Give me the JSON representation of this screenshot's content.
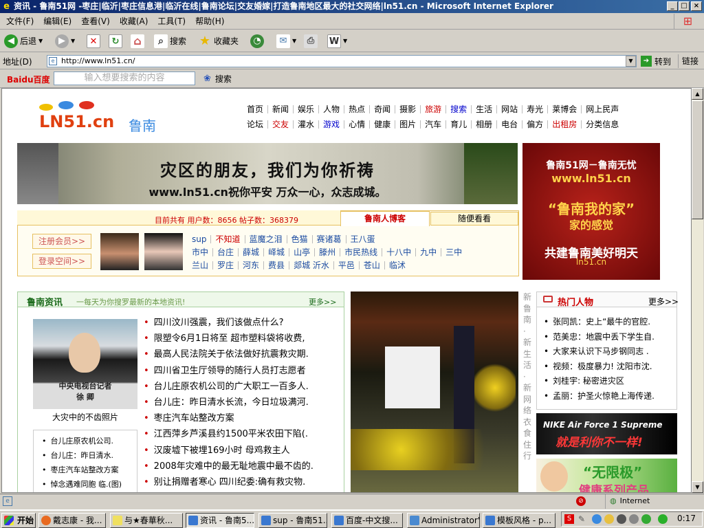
{
  "window": {
    "title": "资讯 - 鲁南51网 -枣庄|临沂|枣庄信息港|临沂在线|鲁南论坛|交友婚嫁|打造鲁南地区最大的社交网络|ln51.cn - Microsoft Internet Explorer"
  },
  "menu": [
    "文件(F)",
    "编辑(E)",
    "查看(V)",
    "收藏(A)",
    "工具(T)",
    "帮助(H)"
  ],
  "toolbar": {
    "back": "后退",
    "search": "搜索",
    "favorites": "收藏夹"
  },
  "address": {
    "label": "地址(D)",
    "url": "http://www.ln51.cn/",
    "go": "转到",
    "links": "链接"
  },
  "baidu": {
    "logo": "Baidu百度",
    "placeholder": "输入想要搜索的内容",
    "search": "搜索"
  },
  "site": {
    "logo": "LN51.cn",
    "logo_cn": "鲁南",
    "nav_row1": [
      "首页",
      "新闻",
      "娱乐",
      "人物",
      "热点",
      "奇闻",
      "摄影",
      "旅游",
      "搜索",
      "生活",
      "网站",
      "寿光",
      "莱博会",
      "网上民声"
    ],
    "nav_row2": [
      "论坛",
      "交友",
      "灌水",
      "游戏",
      "心情",
      "健康",
      "图片",
      "汽车",
      "育儿",
      "相册",
      "电台",
      "偏方",
      "出租房",
      "分类信息"
    ],
    "banner": {
      "line1": "灾区的朋友，我们为你祈祷",
      "line2": "www.ln51.cn祝你平安 万众一心，众志成城。"
    },
    "side_ad": {
      "line1": "鲁南51网－鲁南无忧",
      "line2": "www.ln51.cn",
      "line3": "“鲁南我的家”",
      "line4": "家的感觉",
      "line5": "共建鲁南美好明天",
      "line6": "ln51.cn"
    },
    "stats": "目前共有 用户数：8656 帖子数：368379",
    "tabs": [
      "鲁南人博客",
      "随便看看"
    ],
    "buttons": [
      "注册会员>>",
      "登录空间>>"
    ],
    "blog_row1": [
      "sup",
      "不知道",
      "蓝魔之泪",
      "色猫",
      "赛诸葛",
      "王八蛋"
    ],
    "blog_row2": [
      "市中",
      "台庄",
      "薛城",
      "峄城",
      "山亭",
      "滕州",
      "市民热线",
      "十八中",
      "九中",
      "三中"
    ],
    "blog_row3": [
      "兰山",
      "罗庄",
      "河东",
      "费县",
      "郯城 沂水",
      "平邑",
      "苍山",
      "临沭"
    ]
  },
  "news_section": {
    "title": "鲁南资讯",
    "subtitle": "一每天为你搜罗最新的本地资讯!",
    "more": "更多>>",
    "photo_caption": "大灾中的不齿照片",
    "photo_text": "中央电视台记者\n徐 卿",
    "items": [
      "四川汶川强震，我们该做点什么?",
      "限塑令6月1日将至 超市塑料袋将收费,",
      "最高人民法院关于依法做好抗震救灾期.",
      "四川省卫生厅领导的随行人员打志愿者",
      "台儿庄原农机公司的广大职工一百多人.",
      "台儿庄：昨日清水长流，今日垃圾满河.",
      "枣庄汽车站整改方案",
      "江西萍乡芦溪县约1500平米农田下陷(.",
      "汉废墟下被埋169小时 母鸡救主人",
      "2008年灾难中的最无耻地震中最不齿的.",
      "别让捐赠者寒心 四川纪委:确有救灾物."
    ],
    "sub_items": [
      "台儿庄原农机公司.",
      "台儿庄：昨日清水.",
      "枣庄汽车站整改方案",
      "悼念遇难同胞 临.(图)"
    ],
    "vertical_text": "新鲁南·新生活·新网络 衣食住行"
  },
  "hot_people": {
    "title": "热门人物",
    "more": "更多>>",
    "items": [
      "张同凯：史上“最牛的官腔.",
      "范美忠：地震中丢下学生自.",
      "大家来认识下马步钢同志 .",
      "视频：极度暴力! 沈阳市沈.",
      "刘桂宇: 秘密进灾区",
      "孟丽：护圣火惊艳上海传递."
    ]
  },
  "ads": {
    "nike_line1": "NIKE Air Force 1 Supreme",
    "nike_line2": "就是利你不一样!",
    "health_line1": "“无限极”",
    "health_line2": "健康系列产品"
  },
  "status": {
    "zone": "Internet"
  },
  "taskbar": {
    "start": "开始",
    "tasks": [
      "戴志康 - 我...",
      "与★春華秋...",
      "资讯 - 鲁南5...",
      "sup - 鲁南51...",
      "百度-中文搜...",
      "Administrator'...",
      "模板风格 - p..."
    ],
    "clock": "0:17"
  },
  "colors": {
    "title_bar": "#0a246a",
    "site_red": "#c00000",
    "site_green": "#2a7a2a",
    "ad_red": "#8b0a0a"
  }
}
